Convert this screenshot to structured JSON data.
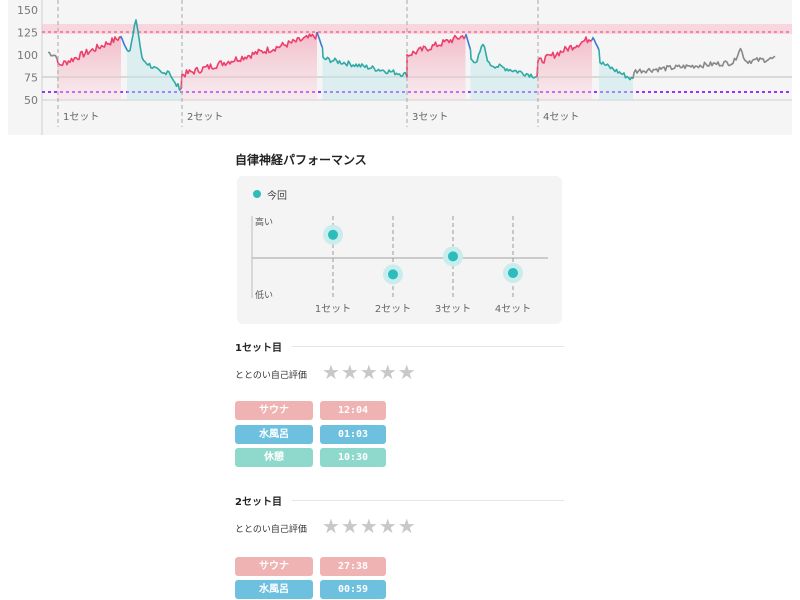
{
  "heart_rate_chart": {
    "y_ticks": [
      "150",
      "125",
      "100",
      "75",
      "50"
    ],
    "set_labels": [
      "1セット",
      "2セット",
      "3セット",
      "4セット"
    ],
    "colors": {
      "sauna": "#ee3f6c",
      "water": "#3a7bd5",
      "rest": "#2fa9a4",
      "after": "#888888",
      "upper_line": "#f06b8a",
      "lower_line": "#9b30ff"
    }
  },
  "autonomic_performance": {
    "title": "自律神経パフォーマンス",
    "legend_label": "今回",
    "y_high": "高い",
    "y_low": "低い",
    "colors": {
      "dot": "#2bbcbc",
      "halo": "#c9ecec"
    },
    "chart_data": {
      "type": "scatter",
      "categories": [
        "1セット",
        "2セット",
        "3セット",
        "4セット"
      ],
      "series": [
        {
          "name": "今回",
          "values": [
            0.85,
            0.3,
            0.55,
            0.32
          ]
        }
      ],
      "ylim": [
        0,
        1
      ],
      "y_tick_labels": [
        "低い",
        "高い"
      ]
    }
  },
  "sets": [
    {
      "title": "1セット目",
      "rating_label": "ととのい自己評価",
      "stars": "★★★★★",
      "phases": [
        {
          "label": "サウナ",
          "time": "12:04",
          "type": "sauna"
        },
        {
          "label": "水風呂",
          "time": "01:03",
          "type": "water"
        },
        {
          "label": "休憩",
          "time": "10:30",
          "type": "rest"
        }
      ]
    },
    {
      "title": "2セット目",
      "rating_label": "ととのい自己評価",
      "stars": "★★★★★",
      "phases": [
        {
          "label": "サウナ",
          "time": "27:38",
          "type": "sauna"
        },
        {
          "label": "水風呂",
          "time": "00:59",
          "type": "water"
        }
      ]
    }
  ]
}
